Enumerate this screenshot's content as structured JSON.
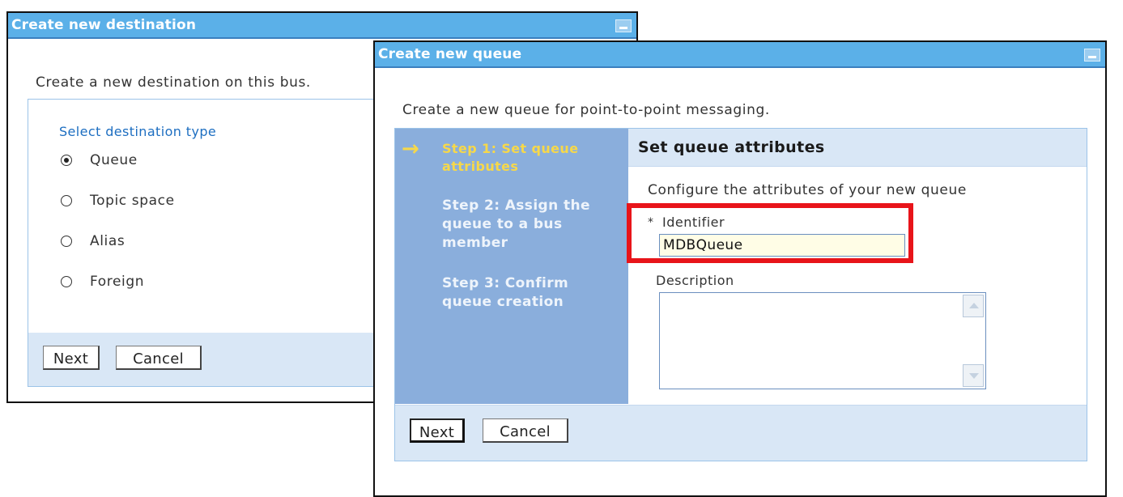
{
  "dest_dialog": {
    "title": "Create new destination",
    "intro": "Create a new destination on this bus.",
    "legend": "Select destination type",
    "options": [
      {
        "label": "Queue",
        "checked": true
      },
      {
        "label": "Topic space",
        "checked": false
      },
      {
        "label": "Alias",
        "checked": false
      },
      {
        "label": "Foreign",
        "checked": false
      }
    ],
    "next_label": "Next",
    "cancel_label": "Cancel"
  },
  "queue_dialog": {
    "title": "Create new queue",
    "intro": "Create a new queue for point-to-point messaging.",
    "steps": [
      {
        "label": "Step 1: Set queue attributes",
        "current": true
      },
      {
        "label": "Step 2: Assign the queue to a bus member",
        "current": false
      },
      {
        "label": "Step 3: Confirm queue creation",
        "current": false
      }
    ],
    "current_arrow": "→",
    "section_title": "Set queue attributes",
    "section_desc": "Configure the attributes of your new queue",
    "required_marker": "*",
    "identifier_label": "Identifier",
    "identifier_value": "MDBQueue",
    "description_label": "Description",
    "description_value": "",
    "next_label": "Next",
    "cancel_label": "Cancel"
  },
  "colors": {
    "title_bar": "#5bb0e8",
    "step_panel": "#8aaedc",
    "current_step": "#f6d84a",
    "highlight_box": "#e8141a",
    "footer": "#d9e7f6"
  }
}
